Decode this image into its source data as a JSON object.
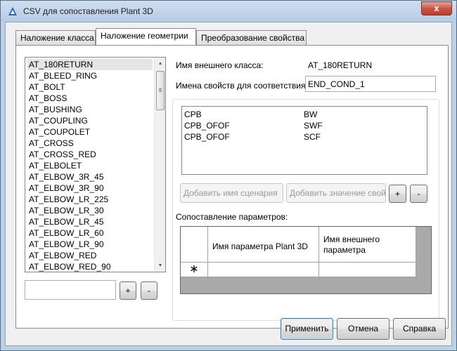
{
  "window": {
    "title": "CSV для сопоставления Plant 3D",
    "close_glyph": "x",
    "icon": "autocad-plant-icon"
  },
  "tabs": [
    {
      "label": "Наложение класса",
      "active": false
    },
    {
      "label": "Наложение геометрии",
      "active": true
    },
    {
      "label": "Преобразование свойства",
      "active": false
    }
  ],
  "class_list": {
    "selected": "AT_180RETURN",
    "items": [
      "AT_180RETURN",
      "AT_BLEED_RING",
      "AT_BOLT",
      "AT_BOSS",
      "AT_BUSHING",
      "AT_COUPLING",
      "AT_COUPOLET",
      "AT_CROSS",
      "AT_CROSS_RED",
      "AT_ELBOLET",
      "AT_ELBOW_3R_45",
      "AT_ELBOW_3R_90",
      "AT_ELBOW_LR_225",
      "AT_ELBOW_LR_30",
      "AT_ELBOW_LR_45",
      "AT_ELBOW_LR_60",
      "AT_ELBOW_LR_90",
      "AT_ELBOW_RED",
      "AT_ELBOW_RED_90"
    ]
  },
  "left_controls": {
    "input_value": "",
    "add_label": "+",
    "remove_label": "-"
  },
  "external_class": {
    "label": "Имя внешнего класса:",
    "value": "AT_180RETURN"
  },
  "match_props": {
    "label": "Имена свойств для соответствия:",
    "value": "END_COND_1"
  },
  "mapping_list": {
    "rows": [
      {
        "name": "CPB",
        "value": "BW"
      },
      {
        "name": "CPB_OFOF",
        "value": "SWF"
      },
      {
        "name": "CPB_OFOF",
        "value": "SCF"
      }
    ]
  },
  "mapping_buttons": {
    "add_name": "Добавить имя сценария",
    "add_value": "Добавить значение свойства",
    "plus": "+",
    "minus": "-"
  },
  "params": {
    "label": "Сопоставление параметров:",
    "columns": [
      "Имя параметра Plant 3D",
      "Имя внешнего параметра"
    ],
    "new_row_marker": "∗"
  },
  "footer": {
    "apply": "Применить",
    "cancel": "Отмена",
    "help": "Справка"
  },
  "colors": {
    "title_bar": "#bcd0e8",
    "close_button": "#c8513f",
    "selection": "#e5e5e5",
    "grid_background": "#a9a9a9"
  }
}
